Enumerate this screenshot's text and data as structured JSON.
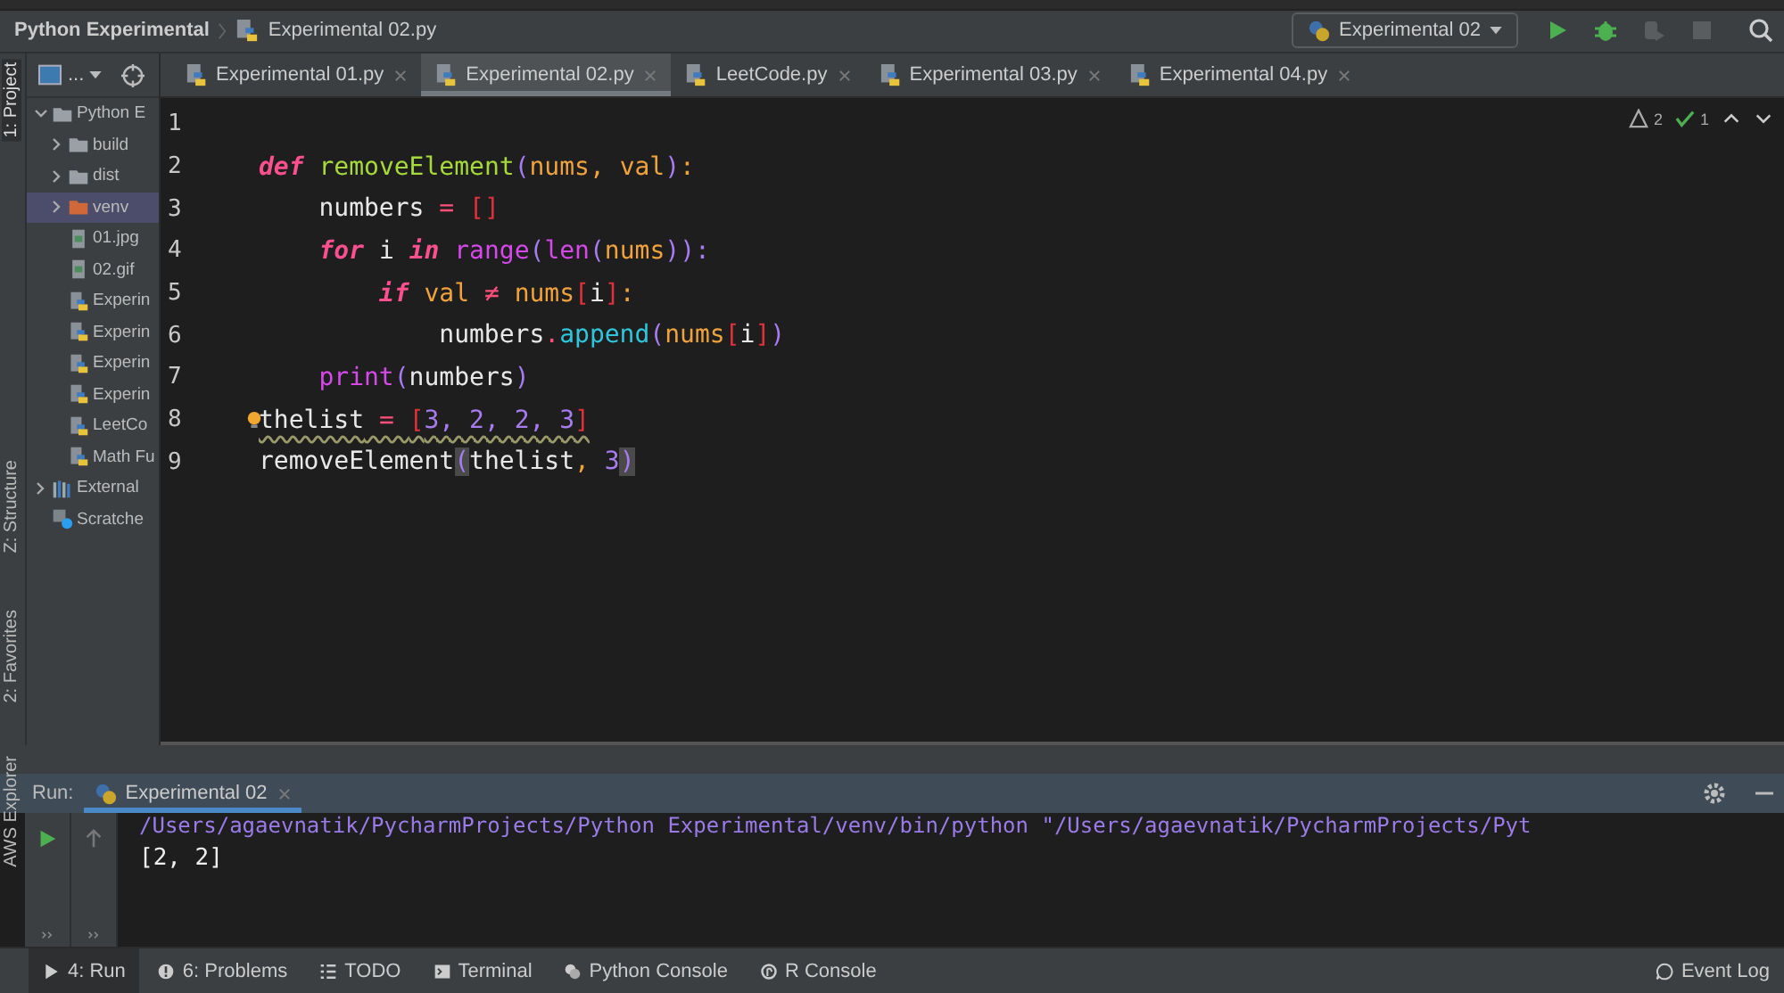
{
  "navbar": {
    "breadcrumb": [
      "Python Experimental",
      "Experimental 02.py"
    ],
    "run_config": "Experimental 02"
  },
  "tool_stripe": [
    {
      "label": "1: Project",
      "selected": true
    },
    {
      "label": "Z: Structure",
      "selected": false
    },
    {
      "label": "2: Favorites",
      "selected": false
    },
    {
      "label": "AWS Explorer",
      "selected": false
    }
  ],
  "project_toolbar": {
    "view_label": "..."
  },
  "tree": [
    {
      "label": "Python E",
      "kind": "folder",
      "expanded": true,
      "selected": false,
      "children": [
        {
          "label": "build",
          "kind": "folder",
          "expanded": false,
          "selected": false
        },
        {
          "label": "dist",
          "kind": "folder",
          "expanded": false,
          "selected": false
        },
        {
          "label": "venv",
          "kind": "excluded-folder",
          "expanded": false,
          "selected": true
        },
        {
          "label": "01.jpg",
          "kind": "image",
          "selected": false
        },
        {
          "label": "02.gif",
          "kind": "image",
          "selected": false
        },
        {
          "label": "Experin",
          "kind": "python",
          "selected": false
        },
        {
          "label": "Experin",
          "kind": "python",
          "selected": false
        },
        {
          "label": "Experin",
          "kind": "python",
          "selected": false
        },
        {
          "label": "Experin",
          "kind": "python",
          "selected": false
        },
        {
          "label": "LeetCo",
          "kind": "python",
          "selected": false
        },
        {
          "label": "Math Fu",
          "kind": "python",
          "selected": false
        }
      ]
    },
    {
      "label": "External",
      "kind": "library",
      "expanded": false,
      "selected": false
    },
    {
      "label": "Scratche",
      "kind": "scratch",
      "selected": false
    }
  ],
  "tabs": [
    {
      "label": "Experimental 01.py",
      "selected": false
    },
    {
      "label": "Experimental 02.py",
      "selected": true
    },
    {
      "label": "LeetCode.py",
      "selected": false
    },
    {
      "label": "Experimental 03.py",
      "selected": false
    },
    {
      "label": "Experimental 04.py",
      "selected": false
    }
  ],
  "inspections": {
    "warnings": "2",
    "typos": "1"
  },
  "code": [
    {
      "number": "1",
      "warning": false
    },
    {
      "number": "2",
      "warning": false,
      "tokens": [
        {
          "text": "def",
          "kind": "keyword"
        },
        {
          "text": " removeElement",
          "kind": "function"
        },
        {
          "text": "(",
          "kind": "paren"
        },
        {
          "text": "nums, val",
          "kind": "param"
        },
        {
          "text": ")",
          "kind": "paren"
        },
        {
          "text": ":",
          "kind": "param"
        }
      ]
    },
    {
      "number": "3",
      "warning": false,
      "tokens": [
        {
          "text": "    numbers",
          "kind": "plain"
        },
        {
          "text": " = ",
          "kind": "operator"
        },
        {
          "text": "[]",
          "kind": "bracket"
        }
      ]
    },
    {
      "number": "4",
      "warning": false,
      "tokens": [
        {
          "text": "    for",
          "kind": "keyword"
        },
        {
          "text": " i ",
          "kind": "plain"
        },
        {
          "text": "in",
          "kind": "keyword"
        },
        {
          "text": " range",
          "kind": "builtin"
        },
        {
          "text": "(",
          "kind": "paren"
        },
        {
          "text": "len",
          "kind": "builtin"
        },
        {
          "text": "(",
          "kind": "paren"
        },
        {
          "text": "nums",
          "kind": "param"
        },
        {
          "text": ")):",
          "kind": "paren"
        }
      ]
    },
    {
      "number": "5",
      "warning": false,
      "tokens": [
        {
          "text": "        if",
          "kind": "keyword"
        },
        {
          "text": " val ",
          "kind": "param"
        },
        {
          "text": "≠",
          "kind": "operator"
        },
        {
          "text": " nums",
          "kind": "param"
        },
        {
          "text": "[",
          "kind": "bracket"
        },
        {
          "text": "i",
          "kind": "plain"
        },
        {
          "text": "]",
          "kind": "bracket"
        },
        {
          "text": ":",
          "kind": "param"
        }
      ]
    },
    {
      "number": "6",
      "warning": false,
      "tokens": [
        {
          "text": "            numbers",
          "kind": "plain"
        },
        {
          "text": ".",
          "kind": "operator"
        },
        {
          "text": "append",
          "kind": "method"
        },
        {
          "text": "(",
          "kind": "paren"
        },
        {
          "text": "nums",
          "kind": "param"
        },
        {
          "text": "[",
          "kind": "bracket"
        },
        {
          "text": "i",
          "kind": "plain"
        },
        {
          "text": "]",
          "kind": "bracket"
        },
        {
          "text": ")",
          "kind": "paren"
        }
      ]
    },
    {
      "number": "7",
      "warning": false,
      "tokens": [
        {
          "text": "    print",
          "kind": "builtin"
        },
        {
          "text": "(",
          "kind": "paren"
        },
        {
          "text": "numbers",
          "kind": "plain"
        },
        {
          "text": ")",
          "kind": "paren"
        }
      ]
    },
    {
      "number": "8",
      "warning": true,
      "tokens": [
        {
          "text": "thelist",
          "kind": "plain"
        },
        {
          "text": " = ",
          "kind": "operator"
        },
        {
          "text": "[",
          "kind": "bracket"
        },
        {
          "text": "3, 2, 2, 3",
          "kind": "number"
        },
        {
          "text": "]",
          "kind": "bracket"
        }
      ]
    },
    {
      "number": "9",
      "warning": false,
      "tokens": [
        {
          "text": "removeElement",
          "kind": "plain"
        },
        {
          "text": "(",
          "kind": "matched-paren"
        },
        {
          "text": "thelist",
          "kind": "plain"
        },
        {
          "text": ", ",
          "kind": "param"
        },
        {
          "text": "3",
          "kind": "number"
        },
        {
          "text": ")",
          "kind": "matched-paren"
        }
      ]
    }
  ],
  "run_panel": {
    "label": "Run:",
    "tab": "Experimental 02",
    "command": "/Users/agaevnatik/PycharmProjects/Python Experimental/venv/bin/python \"/Users/agaevnatik/PycharmProjects/Pyt",
    "output": "[2, 2]"
  },
  "bottom_bar": [
    {
      "label": "4: Run",
      "selected": true
    },
    {
      "label": "6: Problems",
      "selected": false
    },
    {
      "label": "TODO",
      "selected": false
    },
    {
      "label": "Terminal",
      "selected": false
    },
    {
      "label": "Python Console",
      "selected": false
    },
    {
      "label": "R Console",
      "selected": false
    }
  ],
  "event_log": "Event Log"
}
